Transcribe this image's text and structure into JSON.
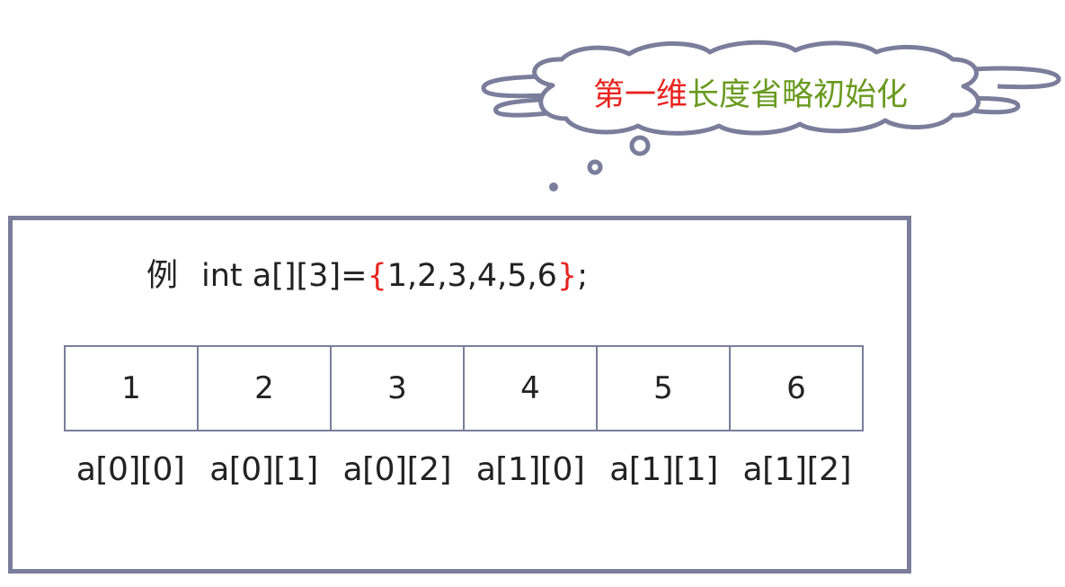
{
  "cloud": {
    "title_part1": "第一维",
    "title_part2": "长度省略初始化",
    "color_part1": "#e8241f",
    "color_part2": "#6a9a1f"
  },
  "example": {
    "label": "例",
    "code_prefix": "int a[][3]=",
    "brace_open": "{",
    "values": "1,2,3,4,5,6",
    "brace_close": "}",
    "code_suffix": ";",
    "brace_color": "#e8241f"
  },
  "cells": [
    "1",
    "2",
    "3",
    "4",
    "5",
    "6"
  ],
  "indices": [
    "a[0][0]",
    "a[0][1]",
    "a[0][2]",
    "a[1][0]",
    "a[1][1]",
    "a[1][2]"
  ],
  "colors": {
    "border": "#7a7e9b"
  }
}
